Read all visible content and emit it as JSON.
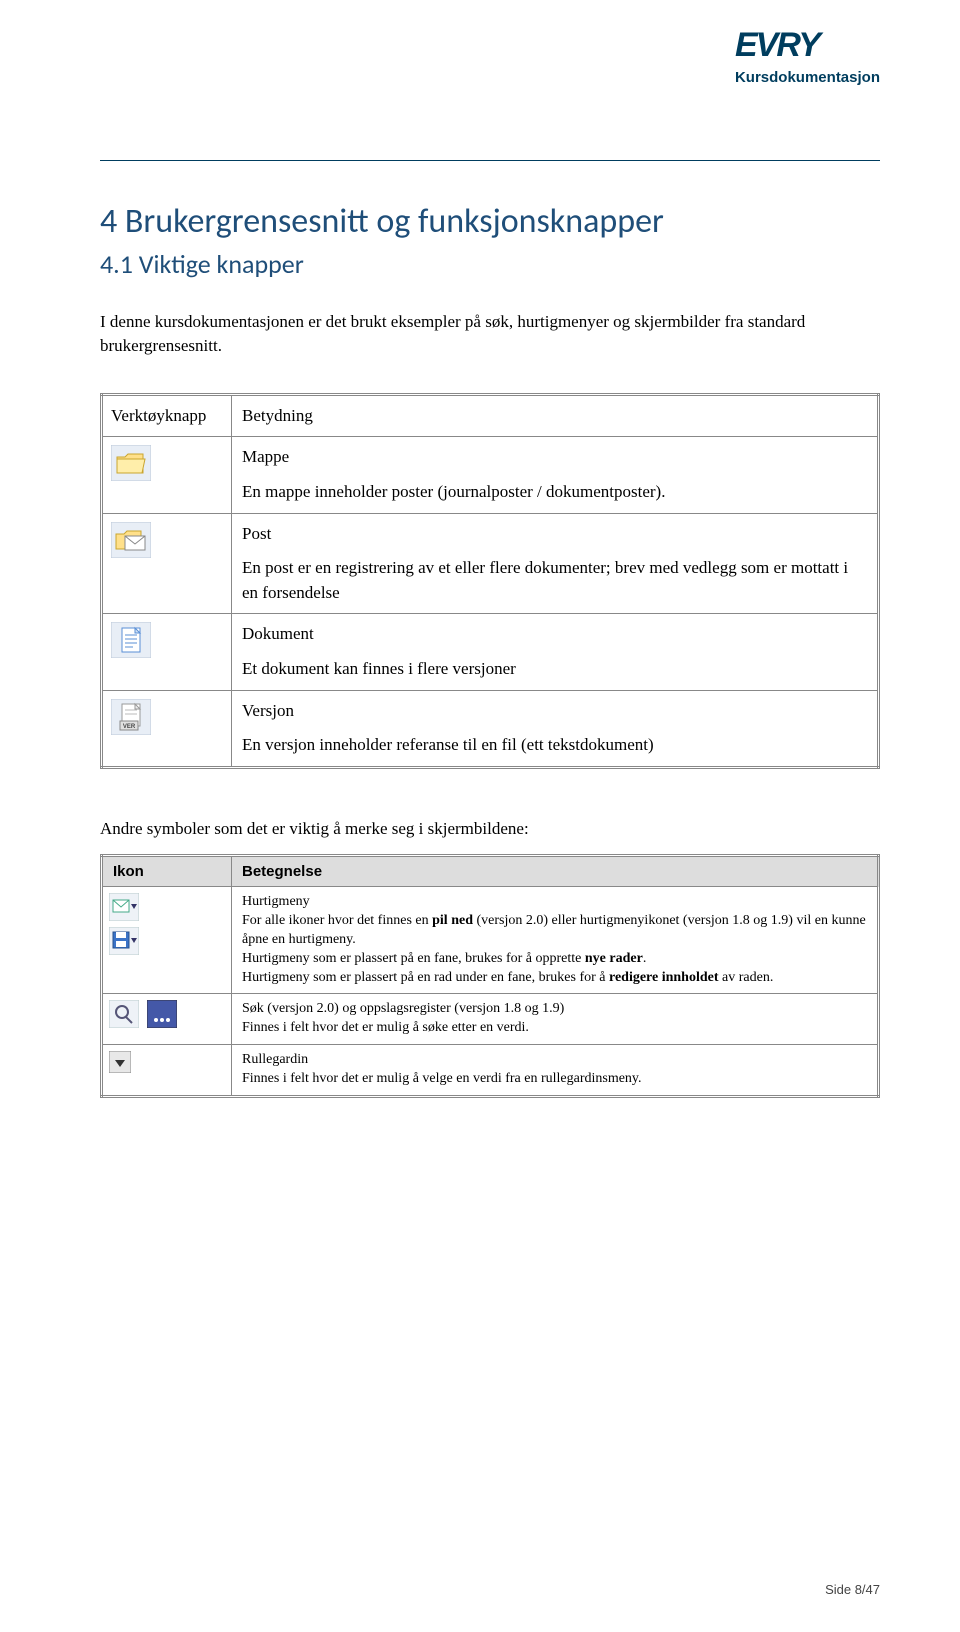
{
  "header": {
    "logo_text": "EVRY",
    "subtitle": "Kursdokumentasjon"
  },
  "h1": "4  Brukergrensesnitt og funksjonsknapper",
  "h2": "4.1 Viktige knapper",
  "intro": "I denne kursdokumentasjonen er det brukt eksempler på søk, hurtigmenyer og skjermbilder fra standard brukergrensesnitt.",
  "table1": {
    "header": {
      "col1": "Verktøyknapp",
      "col2": "Betydning"
    },
    "rows": [
      {
        "icon": "folder",
        "term": "Mappe",
        "desc": "En mappe inneholder poster (journalposter / dokumentposter)."
      },
      {
        "icon": "post",
        "term": "Post",
        "desc": "En post er en registrering av et eller flere dokumenter; brev med vedlegg som er mottatt i en forsendelse"
      },
      {
        "icon": "document",
        "term": "Dokument",
        "desc": "Et dokument kan finnes i flere versjoner"
      },
      {
        "icon": "version",
        "term": "Versjon",
        "desc": "En versjon inneholder referanse til en fil (ett tekstdokument)"
      }
    ]
  },
  "subhead": "Andre symboler som det er viktig å merke seg i skjermbildene:",
  "table2": {
    "header": {
      "col1": "Ikon",
      "col2": "Betegnelse"
    },
    "rows": [
      {
        "icons": [
          "mail-arrow",
          "disk-arrow"
        ],
        "lines": [
          {
            "text": "Hurtigmeny",
            "bold_inline": null
          },
          {
            "text": "For alle ikoner hvor det finnes en ",
            "bold_inline": "pil ned",
            "after": " (versjon 2.0) eller hurtigmenyikonet (versjon 1.8 og 1.9) vil en kunne åpne en hurtigmeny."
          },
          {
            "text": "Hurtigmeny som er plassert på en fane, brukes for å opprette ",
            "bold_inline": "nye rader",
            "after": "."
          },
          {
            "text": "Hurtigmeny som er plassert på en rad under en fane, brukes for å ",
            "bold_inline": "redigere innholdet",
            "after": " av raden."
          }
        ]
      },
      {
        "icons": [
          "search",
          "dots"
        ],
        "lines": [
          {
            "text": "Søk (versjon 2.0) og oppslagsregister (versjon 1.8 og 1.9)"
          },
          {
            "text": "Finnes i felt hvor det er mulig å søke etter en verdi."
          }
        ]
      },
      {
        "icons": [
          "dropdown"
        ],
        "lines": [
          {
            "text": "Rullegardin"
          },
          {
            "text": "Finnes i felt hvor det er mulig å velge en verdi fra en rullegardinsmeny."
          }
        ]
      }
    ]
  },
  "footer": "Side 8/47"
}
